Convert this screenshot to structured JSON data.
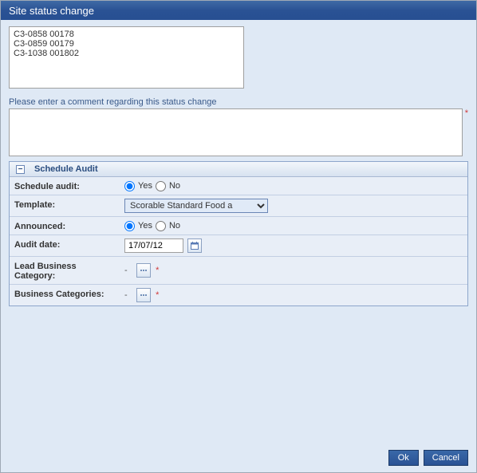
{
  "title": "Site status change",
  "site_list": "C3-0858 00178\nC3-0859 00179\nC3-1038 001802",
  "comment_label": "Please enter a comment regarding this status change",
  "comment_value": "",
  "required_mark": "*",
  "panel": {
    "title": "Schedule Audit",
    "rows": {
      "schedule_audit": {
        "label": "Schedule audit:",
        "yes": "Yes",
        "no": "No",
        "value": "yes"
      },
      "template": {
        "label": "Template:",
        "selected": "Scorable Standard Food a"
      },
      "announced": {
        "label": "Announced:",
        "yes": "Yes",
        "no": "No",
        "value": "yes"
      },
      "audit_date": {
        "label": "Audit date:",
        "value": "17/07/12"
      },
      "lead_business_category": {
        "label": "Lead Business Category:",
        "value": "-"
      },
      "business_categories": {
        "label": "Business Categories:",
        "value": "-"
      }
    }
  },
  "buttons": {
    "ok": "Ok",
    "cancel": "Cancel"
  }
}
